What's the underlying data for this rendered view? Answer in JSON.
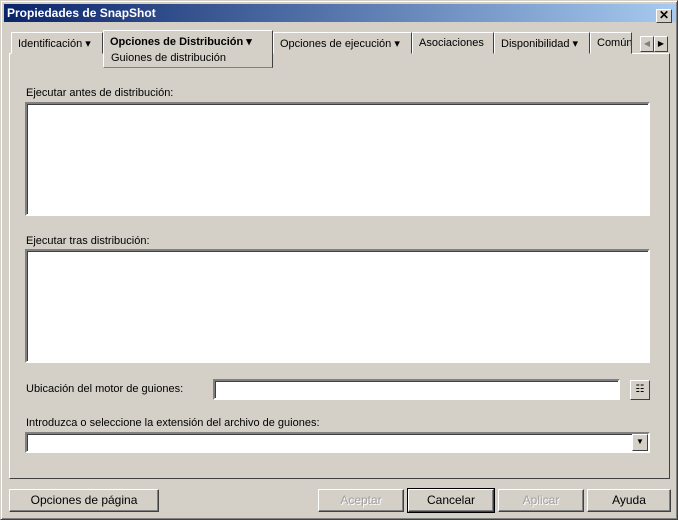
{
  "window": {
    "title": "Propiedades de SnapShot",
    "close": "✕"
  },
  "tabs": [
    {
      "label": "Identificación ▾"
    },
    {
      "label": "Opciones de Distribución ▾"
    },
    {
      "label": "Opciones de ejecución ▾"
    },
    {
      "label": "Asociaciones"
    },
    {
      "label": "Disponibilidad ▾"
    },
    {
      "label": "Común"
    }
  ],
  "subtab": "Guiones de distribución",
  "form": {
    "before_label": "Ejecutar antes de distribución:",
    "after_label": "Ejecutar tras distribución:",
    "engine_label": "Ubicación del motor de guiones:",
    "engine_value": "",
    "ext_label": "Introduzca o seleccione la extensión del archivo de guiones:",
    "ext_value": ""
  },
  "buttons": {
    "page_options": "Opciones de página",
    "ok": "Aceptar",
    "cancel": "Cancelar",
    "apply": "Aplicar",
    "help": "Ayuda"
  }
}
